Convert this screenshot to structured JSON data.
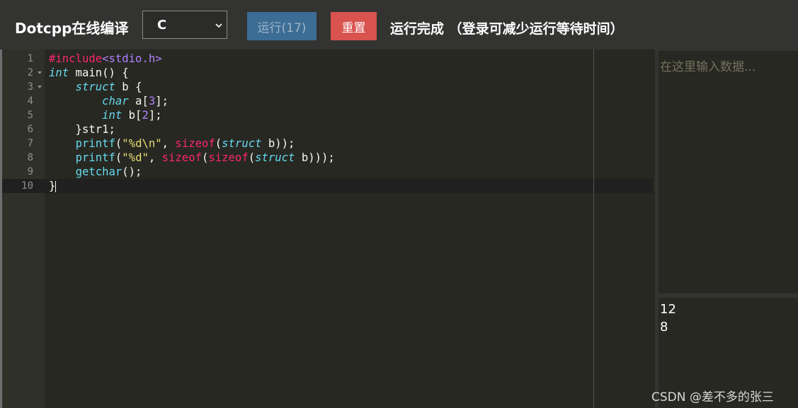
{
  "toolbar": {
    "title": "Dotcpp在线编译",
    "language": {
      "selected": "C"
    },
    "run_label": "运行(17)",
    "reset_label": "重置",
    "status": "运行完成  （登录可减少运行等待时间）"
  },
  "editor": {
    "line_numbers": [
      "1",
      "2",
      "3",
      "4",
      "5",
      "6",
      "7",
      "8",
      "9",
      "10"
    ],
    "lines": [
      [
        {
          "t": "#include",
          "c": "kw"
        },
        {
          "t": "<stdio.h>",
          "c": "inc"
        }
      ],
      [
        {
          "t": "int",
          "c": "ty"
        },
        {
          "t": " main() {",
          "c": ""
        }
      ],
      [
        {
          "t": "    ",
          "c": ""
        },
        {
          "t": "struct",
          "c": "ty"
        },
        {
          "t": " b {",
          "c": ""
        }
      ],
      [
        {
          "t": "        ",
          "c": ""
        },
        {
          "t": "char",
          "c": "ty"
        },
        {
          "t": " a[",
          "c": ""
        },
        {
          "t": "3",
          "c": "num-c"
        },
        {
          "t": "];",
          "c": ""
        }
      ],
      [
        {
          "t": "        ",
          "c": ""
        },
        {
          "t": "int",
          "c": "ty"
        },
        {
          "t": " b[",
          "c": ""
        },
        {
          "t": "2",
          "c": "num-c"
        },
        {
          "t": "];",
          "c": ""
        }
      ],
      [
        {
          "t": "    }str1;",
          "c": ""
        }
      ],
      [
        {
          "t": "    ",
          "c": ""
        },
        {
          "t": "printf",
          "c": "fn"
        },
        {
          "t": "(",
          "c": ""
        },
        {
          "t": "\"%d\\n\"",
          "c": "str"
        },
        {
          "t": ", ",
          "c": ""
        },
        {
          "t": "sizeof",
          "c": "kw"
        },
        {
          "t": "(",
          "c": ""
        },
        {
          "t": "struct",
          "c": "ty"
        },
        {
          "t": " b));",
          "c": ""
        }
      ],
      [
        {
          "t": "    ",
          "c": ""
        },
        {
          "t": "printf",
          "c": "fn"
        },
        {
          "t": "(",
          "c": ""
        },
        {
          "t": "\"%d\"",
          "c": "str"
        },
        {
          "t": ", ",
          "c": ""
        },
        {
          "t": "sizeof",
          "c": "kw"
        },
        {
          "t": "(",
          "c": ""
        },
        {
          "t": "sizeof",
          "c": "kw"
        },
        {
          "t": "(",
          "c": ""
        },
        {
          "t": "struct",
          "c": "ty"
        },
        {
          "t": " b)));",
          "c": ""
        }
      ],
      [
        {
          "t": "    ",
          "c": ""
        },
        {
          "t": "getchar",
          "c": "fn"
        },
        {
          "t": "();",
          "c": ""
        }
      ],
      [
        {
          "t": "}",
          "c": ""
        }
      ]
    ]
  },
  "input": {
    "placeholder": "在这里输入数据..."
  },
  "output": {
    "lines": [
      "12",
      "8"
    ]
  },
  "watermark": "CSDN @差不多的张三"
}
